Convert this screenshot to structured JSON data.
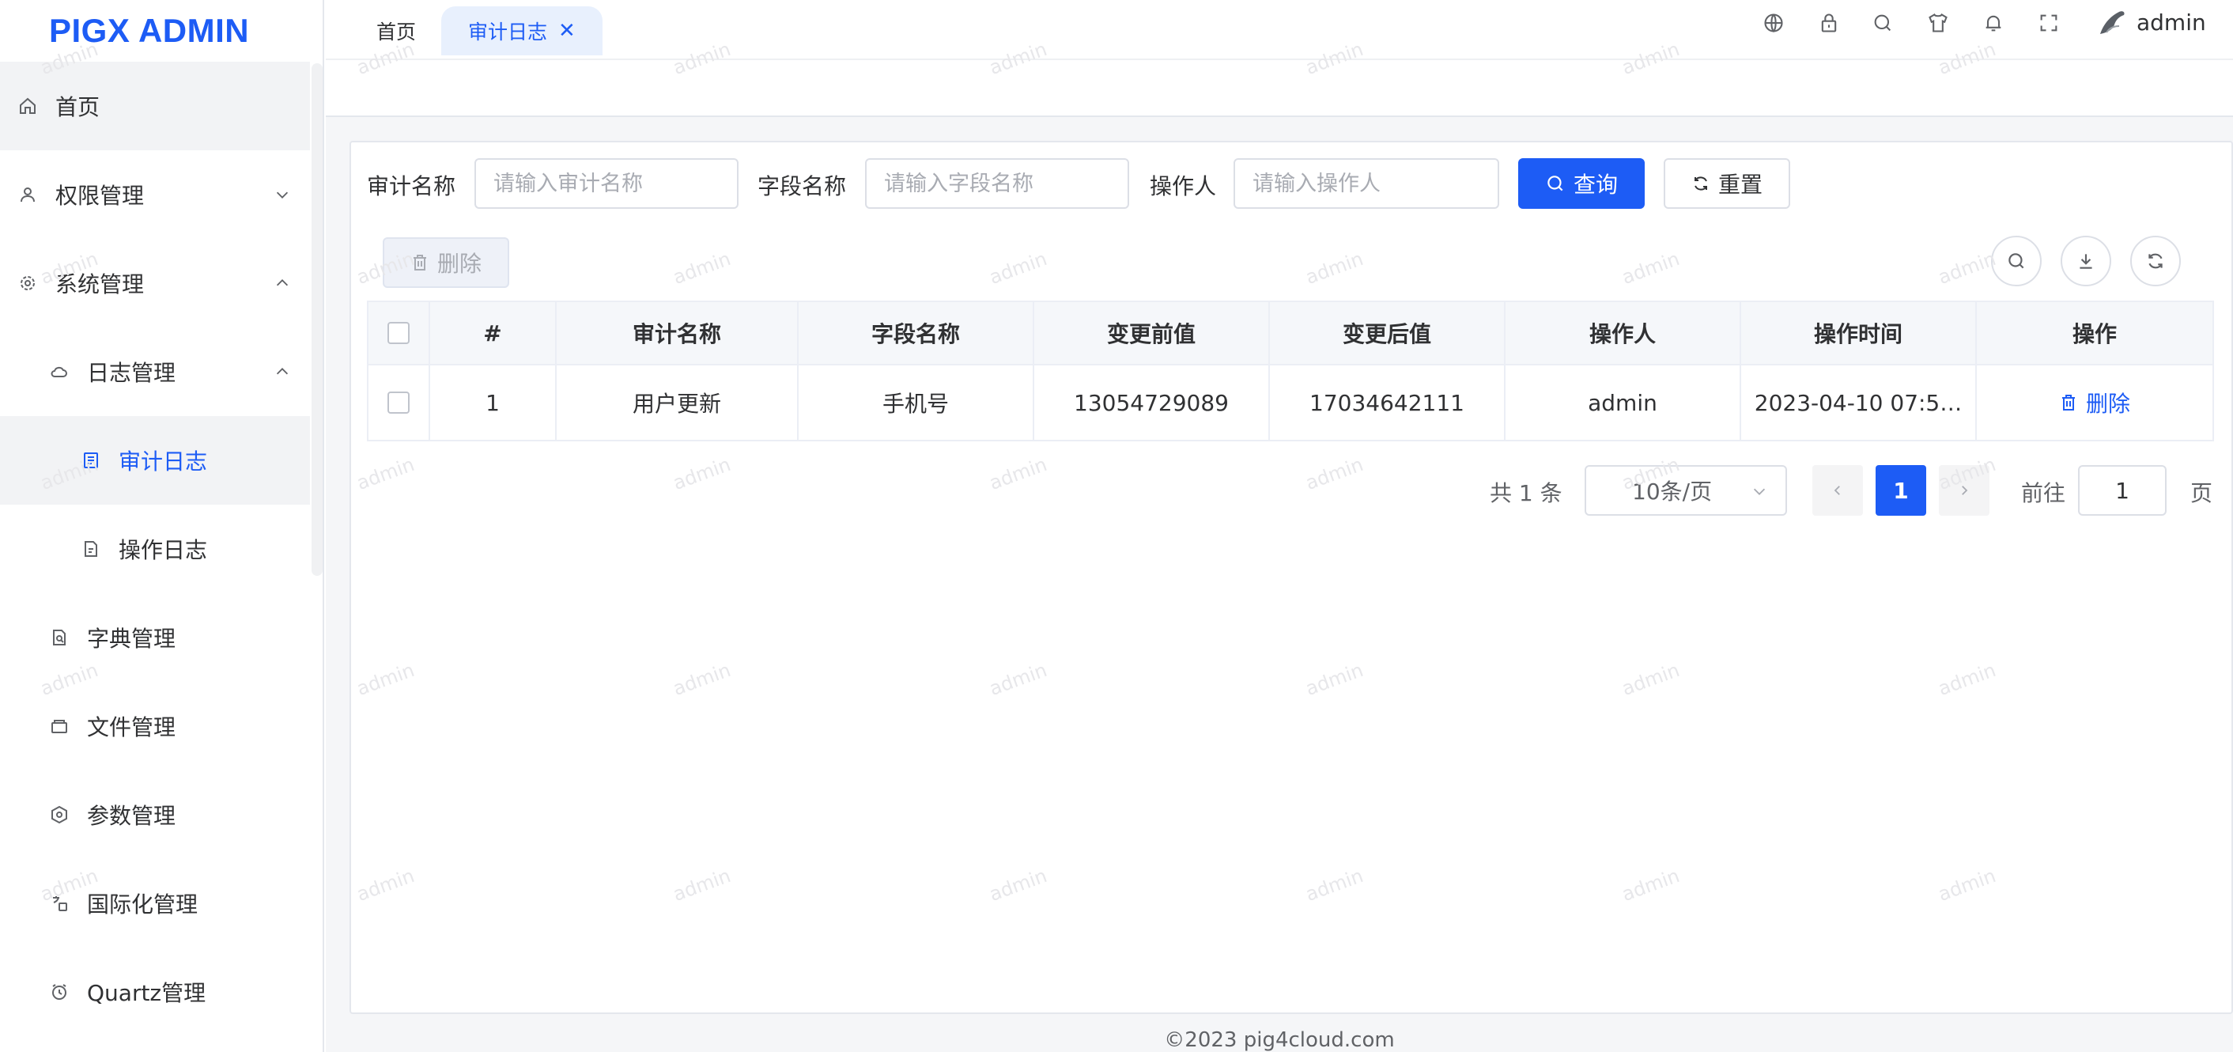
{
  "app": {
    "logo": "PIGX ADMIN"
  },
  "sidebar": {
    "items": [
      {
        "label": "首页",
        "icon": "home-icon"
      },
      {
        "label": "权限管理",
        "icon": "user-icon",
        "expanded": false
      },
      {
        "label": "系统管理",
        "icon": "gear-icon",
        "expanded": true
      },
      {
        "label": "日志管理",
        "icon": "cloud-icon",
        "expanded": true
      },
      {
        "label": "审计日志",
        "icon": "document-icon",
        "selected": true
      },
      {
        "label": "操作日志",
        "icon": "file-icon"
      },
      {
        "label": "字典管理",
        "icon": "dictionary-icon"
      },
      {
        "label": "文件管理",
        "icon": "folder-icon"
      },
      {
        "label": "参数管理",
        "icon": "hexagon-icon"
      },
      {
        "label": "国际化管理",
        "icon": "translate-icon"
      },
      {
        "label": "Quartz管理",
        "icon": "alarm-clock-icon"
      }
    ]
  },
  "header": {
    "icons": [
      "globe-icon",
      "lock-icon",
      "search-icon",
      "shirt-icon",
      "bell-icon",
      "fullscreen-icon"
    ],
    "user": "admin"
  },
  "tabs": [
    {
      "label": "首页",
      "active": false
    },
    {
      "label": "审计日志",
      "active": true
    }
  ],
  "search": {
    "audit_name_label": "审计名称",
    "audit_name_placeholder": "请输入审计名称",
    "field_name_label": "字段名称",
    "field_name_placeholder": "请输入字段名称",
    "operator_label": "操作人",
    "operator_placeholder": "请输入操作人",
    "query_button": "查询",
    "reset_button": "重置"
  },
  "toolbar": {
    "delete_button": "删除"
  },
  "table": {
    "columns": [
      "#",
      "审计名称",
      "字段名称",
      "变更前值",
      "变更后值",
      "操作人",
      "操作时间",
      "操作"
    ],
    "rows": [
      {
        "index": "1",
        "audit_name": "用户更新",
        "field_name": "手机号",
        "before": "13054729089",
        "after": "17034642111",
        "operator": "admin",
        "time": "2023-04-10 07:5…",
        "action": "删除"
      }
    ]
  },
  "pagination": {
    "total": "共 1 条",
    "page_size": "10条/页",
    "current_page": "1",
    "goto_label": "前往",
    "goto_value": "1",
    "page_suffix": "页"
  },
  "footer": "©2023 pig4cloud.com",
  "watermark": "admin",
  "colors": {
    "primary": "#1d5cf5",
    "border": "#dcdfe6",
    "content_bg": "#f5f6f8"
  }
}
